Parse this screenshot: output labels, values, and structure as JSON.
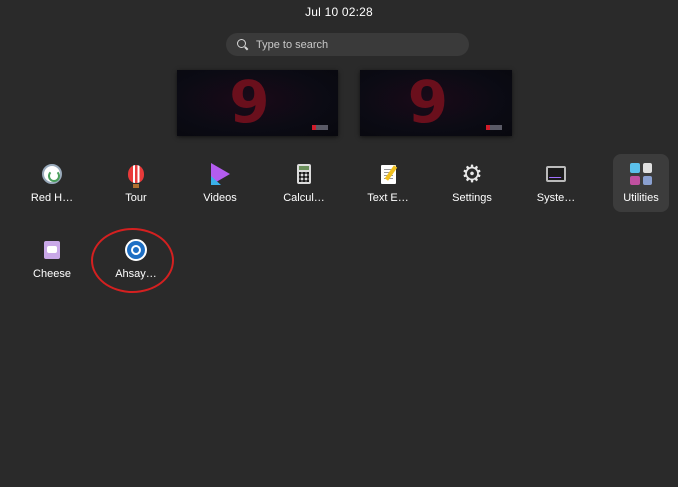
{
  "topbar": {
    "clock": "Jul 10  02:28"
  },
  "search": {
    "placeholder": "Type to search"
  },
  "workspaces": [
    {
      "glyph": "9"
    },
    {
      "glyph": "9"
    }
  ],
  "apps": [
    {
      "label": "Red H…"
    },
    {
      "label": "Tour"
    },
    {
      "label": "Videos"
    },
    {
      "label": "Calcul…"
    },
    {
      "label": "Text E…"
    },
    {
      "label": "Settings"
    },
    {
      "label": "Syste…"
    },
    {
      "label": "Utilities"
    },
    {
      "label": "Cheese"
    },
    {
      "label": "Ahsay…"
    }
  ],
  "icons": {
    "settings_glyph": "⚙",
    "utilities_colors": [
      "#5bc0eb",
      "#e0e0e0",
      "#c050a0",
      "#8aa0d0"
    ]
  },
  "colors": {
    "background": "#2a2a2a",
    "search_bg": "#3a3a3a",
    "selected_bg": "#3c3c3c",
    "annotation": "#d42020"
  }
}
